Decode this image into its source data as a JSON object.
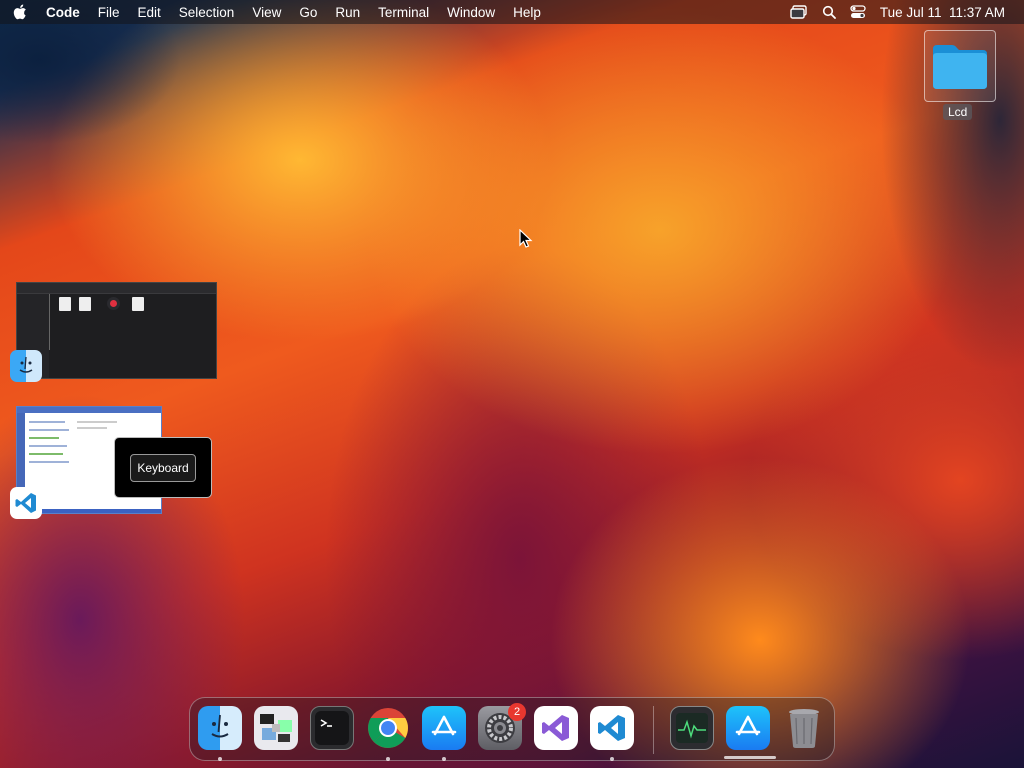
{
  "menubar": {
    "app_name": "Code",
    "menus": [
      "File",
      "Edit",
      "Selection",
      "View",
      "Go",
      "Run",
      "Terminal",
      "Window",
      "Help"
    ],
    "datetime": "Tue Jul 11  11:37 AM",
    "status_icons": [
      "screen-mirroring-icon",
      "spotlight-search-icon",
      "control-center-icon"
    ]
  },
  "desktop": {
    "folder_label": "Lcd"
  },
  "app_switcher": {
    "windows": [
      {
        "app": "Finder",
        "icon": "finder-icon"
      },
      {
        "app": "Visual Studio Code",
        "icon": "vscode-icon"
      }
    ],
    "keyboard_label": "Keyboard"
  },
  "dock": {
    "apps": [
      {
        "icon": "finder-icon",
        "running": true
      },
      {
        "icon": "screenshot-utility-icon",
        "running": false
      },
      {
        "icon": "terminal-icon",
        "running": false
      },
      {
        "icon": "chrome-icon",
        "running": true
      },
      {
        "icon": "app-store-icon",
        "running": true
      },
      {
        "icon": "system-settings-icon",
        "running": false,
        "badge": "2"
      },
      {
        "icon": "visual-studio-icon",
        "running": false
      },
      {
        "icon": "vscode-icon",
        "running": true
      },
      {
        "icon": "activity-monitor-icon",
        "running": false
      },
      {
        "icon": "app-store-downloads-icon",
        "running": false
      },
      {
        "icon": "trash-icon",
        "running": false
      }
    ],
    "settings_badge": "2"
  }
}
